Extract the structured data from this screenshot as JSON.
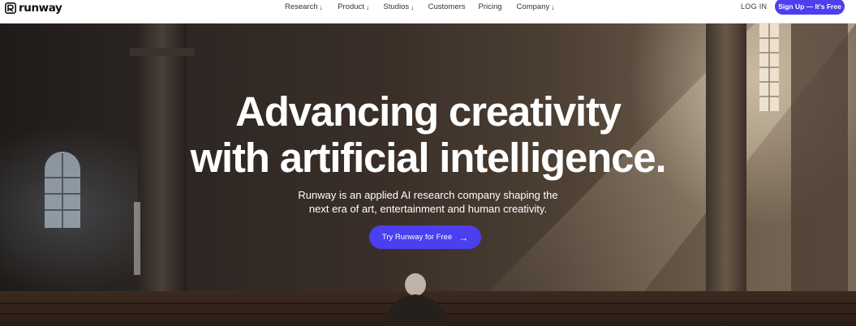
{
  "brand": {
    "name": "runway"
  },
  "nav": {
    "links": [
      {
        "label": "Research",
        "arrow": "↓"
      },
      {
        "label": "Product",
        "arrow": "↓"
      },
      {
        "label": "Studios",
        "arrow": "↓"
      },
      {
        "label": "Customers",
        "arrow": ""
      },
      {
        "label": "Pricing",
        "arrow": ""
      },
      {
        "label": "Company",
        "arrow": "↓"
      }
    ],
    "login": "LOG IN",
    "signup": "Sign Up — It's Free"
  },
  "hero": {
    "headline_line1": "Advancing creativity",
    "headline_line2": "with artificial intelligence.",
    "sub_line1": "Runway is an applied AI research company shaping the",
    "sub_line2": "next era of art, entertainment and human creativity.",
    "cta_label": "Try Runway for Free",
    "cta_icon": "→"
  },
  "colors": {
    "accent": "#4b3ff0",
    "nav_bg": "#ffffff",
    "hero_text": "#ffffff"
  }
}
